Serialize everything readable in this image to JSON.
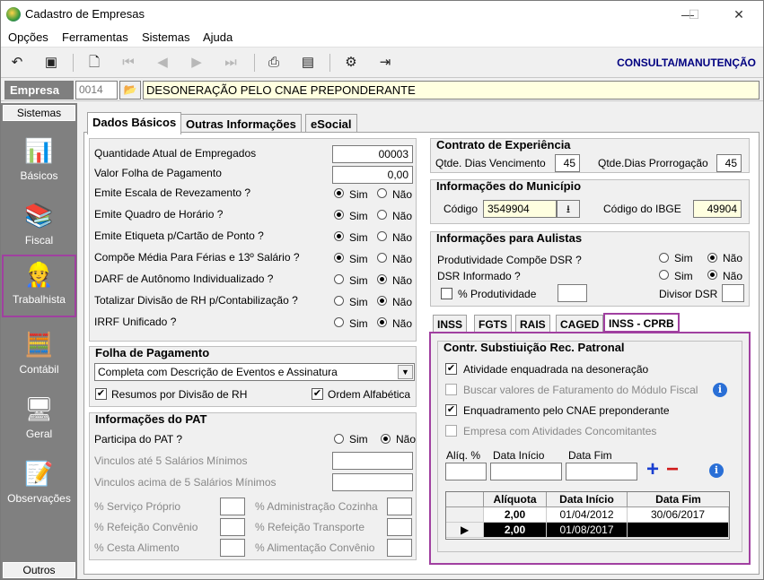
{
  "window": {
    "title": "Cadastro de Empresas"
  },
  "menu": [
    "Opções",
    "Ferramentas",
    "Sistemas",
    "Ajuda"
  ],
  "toolbar": {
    "mode": "CONSULTA/MANUTENÇÃO"
  },
  "company": {
    "label": "Empresa",
    "code": "0014",
    "name": "DESONERAÇÃO PELO CNAE PREPONDERANTE"
  },
  "sidebar": {
    "header": "Sistemas",
    "footer": "Outros",
    "items": [
      "Básicos",
      "Fiscal",
      "Trabalhista",
      "Contábil",
      "Geral",
      "Observações"
    ],
    "selected": "Trabalhista"
  },
  "tabs": [
    "Dados Básicos",
    "Outras Informações",
    "eSocial"
  ],
  "basic": {
    "employees_label": "Quantidade Atual de Empregados",
    "employees_value": "00003",
    "payroll_label": "Valor Folha de Pagamento",
    "payroll_value": "0,00",
    "yes": "Sim",
    "no": "Não",
    "questions": [
      {
        "label": "Emite Escala de Revezamento ?",
        "value": "Sim"
      },
      {
        "label": "Emite Quadro de Horário ?",
        "value": "Sim"
      },
      {
        "label": "Emite Etiqueta p/Cartão de Ponto ?",
        "value": "Sim"
      },
      {
        "label": "Compõe Média Para Férias e 13º Salário ?",
        "value": "Sim"
      },
      {
        "label": "DARF de Autônomo Individualizado ?",
        "value": "Não"
      },
      {
        "label": "Totalizar Divisão de RH p/Contabilização ?",
        "value": "Não"
      },
      {
        "label": "IRRF Unificado ?",
        "value": "Não"
      }
    ]
  },
  "folha": {
    "title": "Folha de Pagamento",
    "option": "Completa com Descrição de Eventos e Assinatura",
    "resumos_label": "Resumos por Divisão de RH",
    "alfabetica_label": "Ordem Alfabética"
  },
  "pat": {
    "title": "Informações do PAT",
    "participa_label": "Participa do PAT ?",
    "participa_value": "Não",
    "vinc5_label": "Vinculos até 5 Salários Mínimos",
    "vinc5plus_label": "Vinculos acima de 5 Salários Mínimos",
    "servico_label": "% Serviço Próprio",
    "admin_label": "% Administração Cozinha",
    "refeicao_label": "% Refeição Convênio",
    "transporte_label": "% Refeição Transporte",
    "cesta_label": "% Cesta Alimento",
    "alimentacao_label": "% Alimentação Convênio"
  },
  "contrato": {
    "title": "Contrato de Experiência",
    "venc_label": "Qtde. Dias Vencimento",
    "venc_value": "45",
    "prorr_label": "Qtde.Dias Prorrogação",
    "prorr_value": "45"
  },
  "municipio": {
    "title": "Informações do Município",
    "codigo_label": "Código",
    "codigo_value": "3549904",
    "ibge_label": "Código do IBGE",
    "ibge_value": "49904"
  },
  "aulistas": {
    "title": "Informações para Aulistas",
    "prod_label": "Produtividade Compõe DSR ?",
    "prod_value": "Não",
    "dsr_label": "DSR Informado ?",
    "dsr_value": "Não",
    "perc_label": "% Produtividade",
    "divisor_label": "Divisor DSR"
  },
  "subtabs": [
    "INSS",
    "FGTS",
    "RAIS",
    "CAGED",
    "INSS - CPRB"
  ],
  "cprb": {
    "title": "Contr. Substiuição Rec. Patronal",
    "opt1": "Atividade enquadrada na desoneração",
    "opt2": "Buscar valores de Faturamento do Módulo Fiscal",
    "opt3": "Enquadramento pelo CNAE preponderante",
    "opt4": "Empresa com Atividades Concomitantes",
    "aliq_label": "Alíq. %",
    "inicio_label": "Data Início",
    "fim_label": "Data Fim",
    "columns": [
      "Alíquota",
      "Data Início",
      "Data Fim"
    ],
    "rows": [
      {
        "aliquota": "2,00",
        "inicio": "01/04/2012",
        "fim": "30/06/2017"
      },
      {
        "aliquota": "2,00",
        "inicio": "01/08/2017",
        "fim": ""
      }
    ]
  },
  "colors": {
    "highlight": "#a040a0",
    "mode": "#000080",
    "sidebar": "#808080"
  }
}
